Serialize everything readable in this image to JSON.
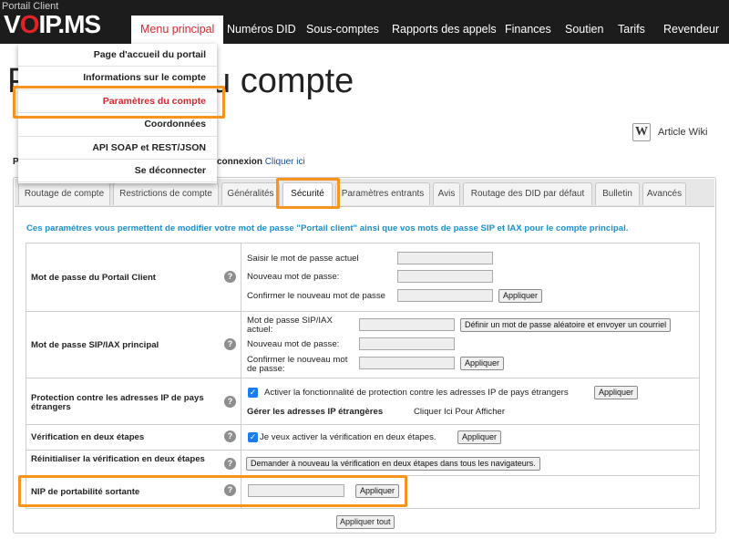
{
  "brand": {
    "portal_label": "Portail Client",
    "logo_pre": "V",
    "logo_o": "O",
    "logo_post": "IP.MS"
  },
  "nav": {
    "items": [
      {
        "label": "Menu principal"
      },
      {
        "label": "Numéros DID"
      },
      {
        "label": "Sous-comptes"
      },
      {
        "label": "Rapports des appels"
      },
      {
        "label": "Finances"
      },
      {
        "label": "Soutien"
      },
      {
        "label": "Tarifs"
      },
      {
        "label": "Revendeur"
      }
    ],
    "active_color": "#d8262c"
  },
  "dropdown": {
    "items": [
      {
        "label": "Page d'accueil du portail"
      },
      {
        "label": "Informations sur le compte"
      },
      {
        "label": "Paramètres du compte"
      },
      {
        "label": "Coordonnées"
      },
      {
        "label": "API SOAP et REST/JSON"
      },
      {
        "label": "Se déconnecter"
      }
    ]
  },
  "page": {
    "title_partial": "u compte",
    "title_prefix": "P",
    "wiki_label": "Article Wiki",
    "wiki_icon": "W",
    "conn_left": "Po",
    "conn_text": "connexion",
    "conn_link": "Cliquer ici"
  },
  "tabs": [
    {
      "label": "Routage de compte"
    },
    {
      "label": "Restrictions de compte"
    },
    {
      "label": "Généralités"
    },
    {
      "label": "Sécurité"
    },
    {
      "label": "Paramètres entrants"
    },
    {
      "label": "Avis"
    },
    {
      "label": "Routage des DID par défaut"
    },
    {
      "label": "Bulletin"
    },
    {
      "label": "Avancés"
    }
  ],
  "security": {
    "intro": "Ces paramètres vous permettent de modifier votre mot de passe \"Portail client\" ainsi que vos mots de passe SIP et IAX pour le compte principal.",
    "portal_pw": {
      "label": "Mot de passe du Portail Client",
      "current": "Saisir le mot de passe actuel",
      "new": "Nouveau mot de passe:",
      "confirm": "Confirmer le nouveau mot de passe",
      "apply": "Appliquer"
    },
    "sip_pw": {
      "label": "Mot de passe SIP/IAX principal",
      "sip_label": "Mot de passe SIP/IAX actuel:",
      "random_btn": "Définir un mot de passe aléatoire et envoyer un courriel",
      "new": "Nouveau mot de passe:",
      "confirm": "Confirmer le nouveau mot de passe:",
      "apply": "Appliquer"
    },
    "foreign_ip": {
      "label": "Protection contre les adresses IP de pays étrangers",
      "check_text": "Activer la fonctionnalité de protection contre les adresses IP de pays étrangers",
      "checked": true,
      "apply": "Appliquer",
      "manage_label": "Gérer les adresses IP étrangères",
      "manage_link": "Cliquer Ici Pour Afficher"
    },
    "two_step": {
      "label": "Vérification en deux étapes",
      "check_text": "Je veux activer la vérification en deux étapes.",
      "checked": true,
      "apply": "Appliquer"
    },
    "reset_two_step": {
      "label": "Réinitialiser la vérification en deux étapes",
      "button": "Demander à nouveau la vérification en deux étapes dans tous les navigateurs."
    },
    "port_pin": {
      "label": "NIP de portabilité sortante",
      "apply": "Appliquer"
    },
    "apply_all": "Appliquer tout",
    "help_icon": "?"
  },
  "highlight_color": "#f7941d"
}
